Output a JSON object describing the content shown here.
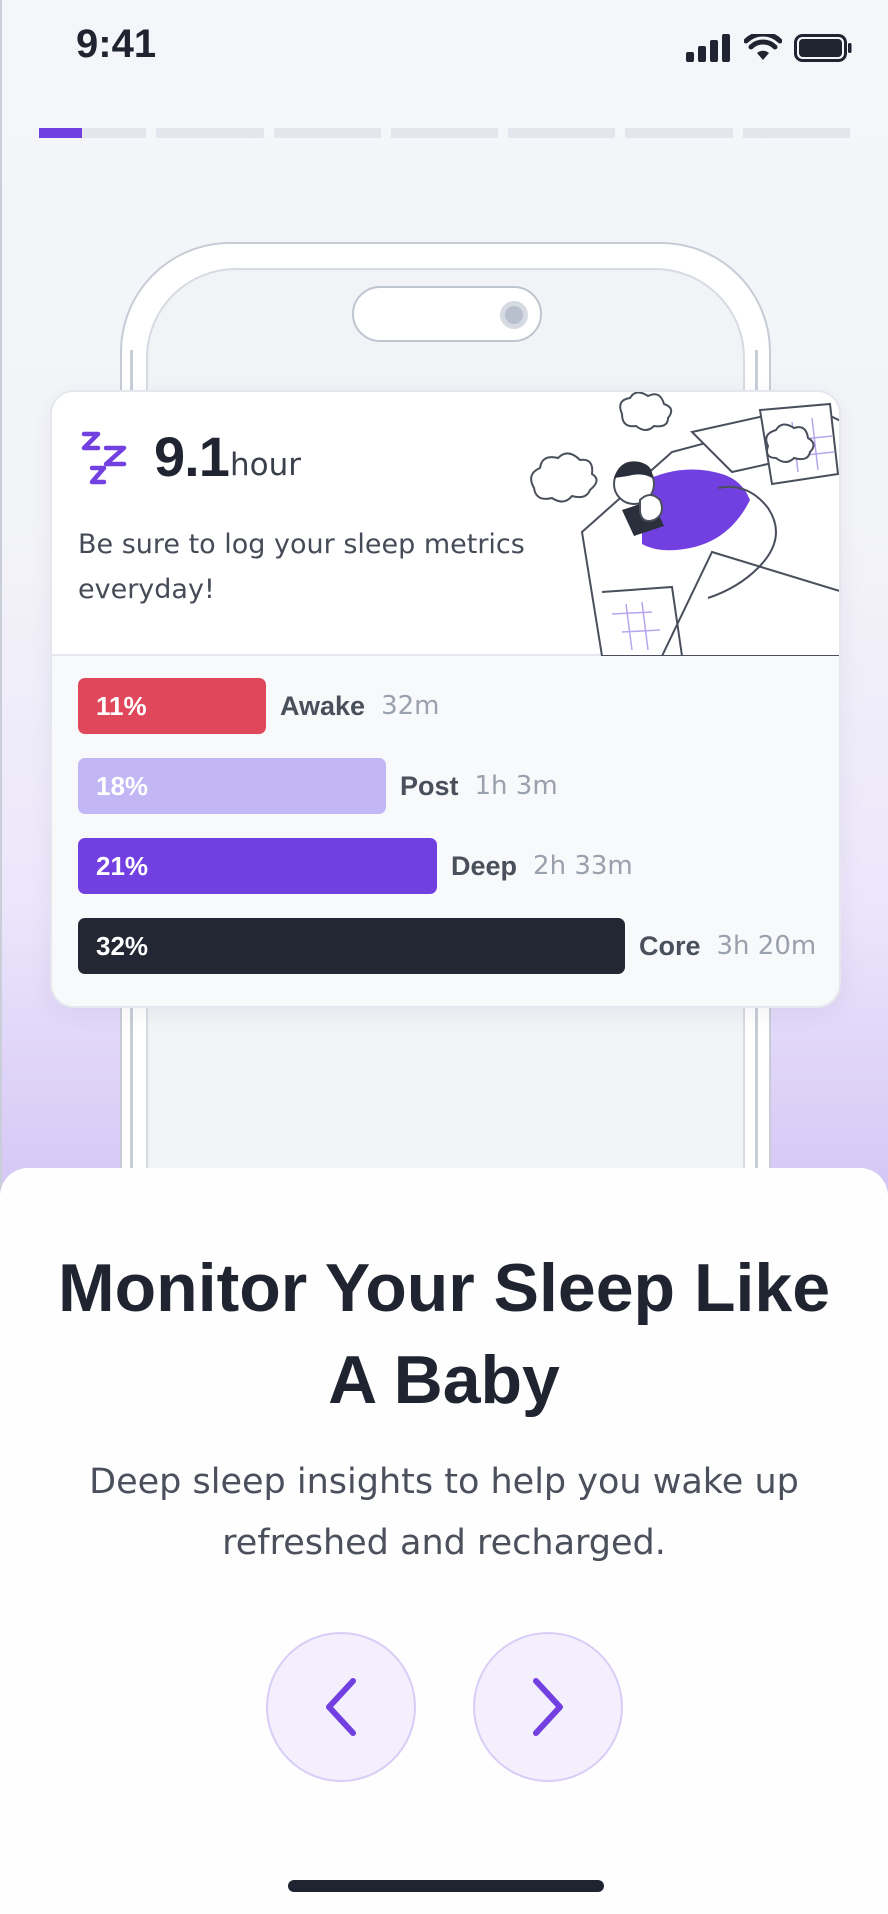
{
  "status_bar": {
    "time": "9:41",
    "icons": [
      "signal-icon",
      "wifi-icon",
      "battery-icon"
    ]
  },
  "onboarding": {
    "total_steps": 7,
    "current_step": 1,
    "current_step_fill": 0.4,
    "accent_color": "#7240e0"
  },
  "sleep_card": {
    "icon": "zz-sleep-icon",
    "hours_value": "9.1",
    "hours_unit": "hour",
    "message": "Be sure to log your sleep metrics everyday!",
    "illustration": "person-sleeping-illustration",
    "stages": [
      {
        "percent_label": "11%",
        "percent": 11,
        "name": "Awake",
        "duration": "32m",
        "color": "#e0475a",
        "text_color": "#ffffff"
      },
      {
        "percent_label": "18%",
        "percent": 18,
        "name": "Post",
        "duration": "1h 3m",
        "color": "#c2b6f5",
        "text_color": "#ffffff"
      },
      {
        "percent_label": "21%",
        "percent": 21,
        "name": "Deep",
        "duration": "2h 33m",
        "color": "#7240e0",
        "text_color": "#ffffff"
      },
      {
        "percent_label": "32%",
        "percent": 32,
        "name": "Core",
        "duration": "3h 20m",
        "color": "#222733",
        "text_color": "#ffffff"
      }
    ]
  },
  "sheet": {
    "title": "Monitor Your Sleep Like A Baby",
    "subtitle": "Deep sleep insights to help you wake up refreshed and recharged.",
    "prev_icon": "chevron-left-icon",
    "next_icon": "chevron-right-icon"
  }
}
